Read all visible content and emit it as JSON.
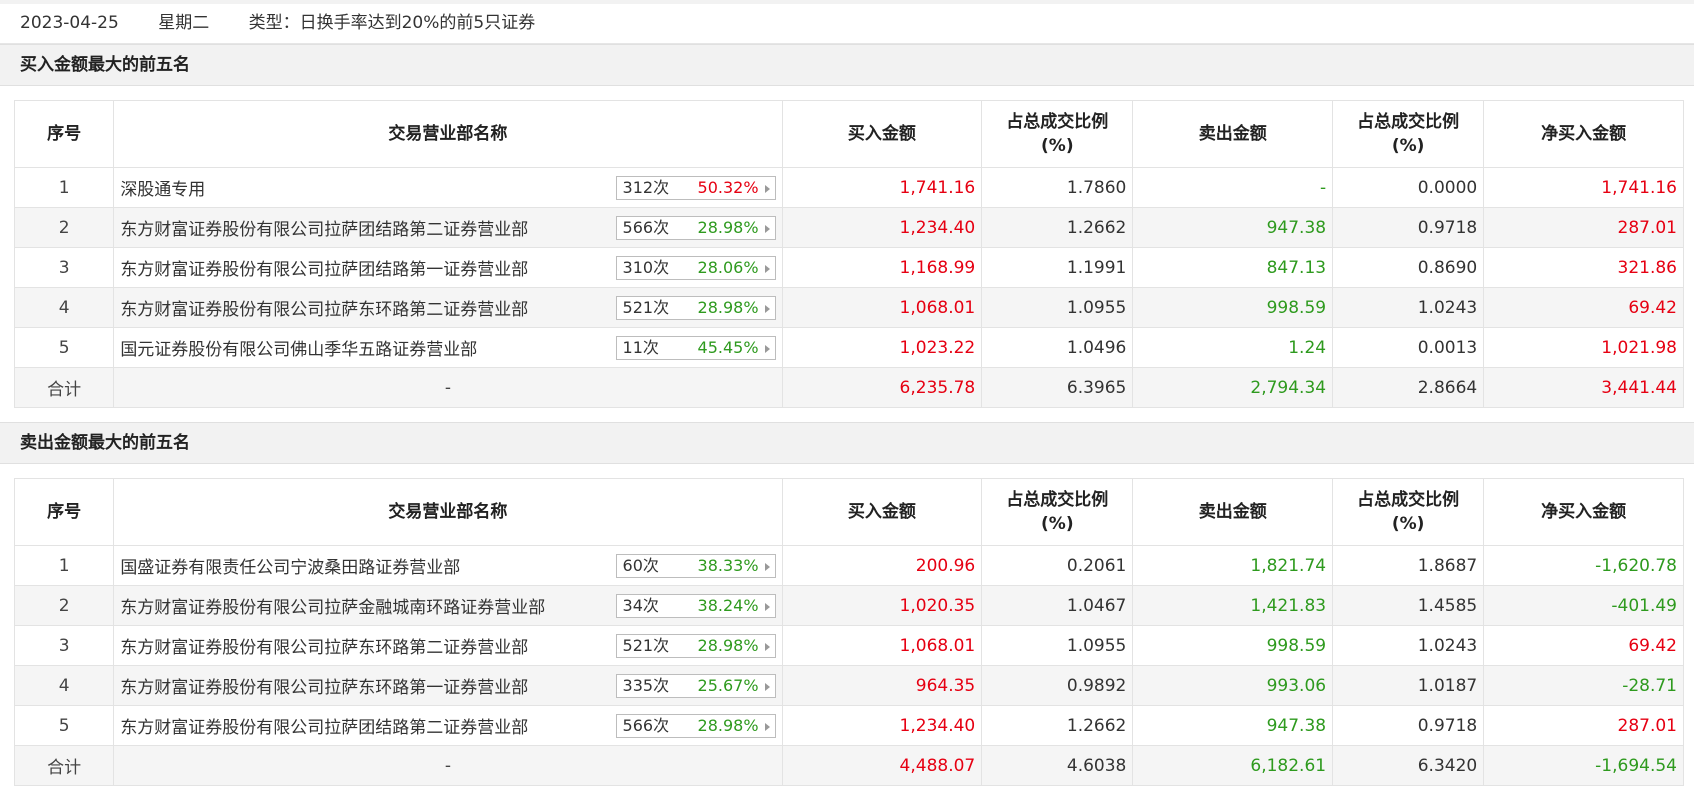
{
  "header": {
    "date": "2023-04-25",
    "weekday": "星期二",
    "type_text": "类型：日换手率达到20%的前5只证券"
  },
  "columns": {
    "seq": "序号",
    "name": "交易营业部名称",
    "buy": "买入金额",
    "buy_ratio_l1": "占总成交比例",
    "buy_ratio_l2": "(%)",
    "sell": "卖出金额",
    "sell_ratio_l1": "占总成交比例",
    "sell_ratio_l2": "(%)",
    "net": "净买入金额"
  },
  "buy_top": {
    "title": "买入金额最大的前五名",
    "rows": [
      {
        "seq": "1",
        "name": "深股通专用",
        "times": "312次",
        "pct": "50.32%",
        "pct_color": "red",
        "buy": "1,741.16",
        "buy_ratio": "1.7860",
        "sell": "-",
        "sell_ratio": "0.0000",
        "net": "1,741.16",
        "net_color": "red"
      },
      {
        "seq": "2",
        "name": "东方财富证券股份有限公司拉萨团结路第二证券营业部",
        "times": "566次",
        "pct": "28.98%",
        "pct_color": "green",
        "buy": "1,234.40",
        "buy_ratio": "1.2662",
        "sell": "947.38",
        "sell_ratio": "0.9718",
        "net": "287.01",
        "net_color": "red"
      },
      {
        "seq": "3",
        "name": "东方财富证券股份有限公司拉萨团结路第一证券营业部",
        "times": "310次",
        "pct": "28.06%",
        "pct_color": "green",
        "buy": "1,168.99",
        "buy_ratio": "1.1991",
        "sell": "847.13",
        "sell_ratio": "0.8690",
        "net": "321.86",
        "net_color": "red"
      },
      {
        "seq": "4",
        "name": "东方财富证券股份有限公司拉萨东环路第二证券营业部",
        "times": "521次",
        "pct": "28.98%",
        "pct_color": "green",
        "buy": "1,068.01",
        "buy_ratio": "1.0955",
        "sell": "998.59",
        "sell_ratio": "1.0243",
        "net": "69.42",
        "net_color": "red"
      },
      {
        "seq": "5",
        "name": "国元证券股份有限公司佛山季华五路证券营业部",
        "times": "11次",
        "pct": "45.45%",
        "pct_color": "green",
        "buy": "1,023.22",
        "buy_ratio": "1.0496",
        "sell": "1.24",
        "sell_ratio": "0.0013",
        "net": "1,021.98",
        "net_color": "red"
      }
    ],
    "total": {
      "label": "合计",
      "name": "-",
      "buy": "6,235.78",
      "buy_ratio": "6.3965",
      "sell": "2,794.34",
      "sell_ratio": "2.8664",
      "net": "3,441.44",
      "net_color": "red"
    }
  },
  "sell_top": {
    "title": "卖出金额最大的前五名",
    "rows": [
      {
        "seq": "1",
        "name": "国盛证券有限责任公司宁波桑田路证券营业部",
        "times": "60次",
        "pct": "38.33%",
        "pct_color": "green",
        "buy": "200.96",
        "buy_ratio": "0.2061",
        "sell": "1,821.74",
        "sell_ratio": "1.8687",
        "net": "-1,620.78",
        "net_color": "green"
      },
      {
        "seq": "2",
        "name": "东方财富证券股份有限公司拉萨金融城南环路证券营业部",
        "times": "34次",
        "pct": "38.24%",
        "pct_color": "green",
        "buy": "1,020.35",
        "buy_ratio": "1.0467",
        "sell": "1,421.83",
        "sell_ratio": "1.4585",
        "net": "-401.49",
        "net_color": "green"
      },
      {
        "seq": "3",
        "name": "东方财富证券股份有限公司拉萨东环路第二证券营业部",
        "times": "521次",
        "pct": "28.98%",
        "pct_color": "green",
        "buy": "1,068.01",
        "buy_ratio": "1.0955",
        "sell": "998.59",
        "sell_ratio": "1.0243",
        "net": "69.42",
        "net_color": "red"
      },
      {
        "seq": "4",
        "name": "东方财富证券股份有限公司拉萨东环路第一证券营业部",
        "times": "335次",
        "pct": "25.67%",
        "pct_color": "green",
        "buy": "964.35",
        "buy_ratio": "0.9892",
        "sell": "993.06",
        "sell_ratio": "1.0187",
        "net": "-28.71",
        "net_color": "green"
      },
      {
        "seq": "5",
        "name": "东方财富证券股份有限公司拉萨团结路第二证券营业部",
        "times": "566次",
        "pct": "28.98%",
        "pct_color": "green",
        "buy": "1,234.40",
        "buy_ratio": "1.2662",
        "sell": "947.38",
        "sell_ratio": "0.9718",
        "net": "287.01",
        "net_color": "red"
      }
    ],
    "total": {
      "label": "合计",
      "name": "-",
      "buy": "4,488.07",
      "buy_ratio": "4.6038",
      "sell": "6,182.61",
      "sell_ratio": "6.3420",
      "net": "-1,694.54",
      "net_color": "green"
    }
  }
}
